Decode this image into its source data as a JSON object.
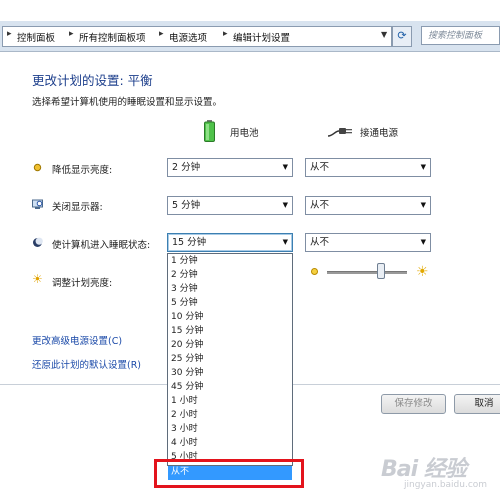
{
  "address_bar": {
    "breadcrumbs": [
      "控制面板",
      "所有控制面板项",
      "电源选项",
      "编辑计划设置"
    ],
    "search_placeholder": "搜索控制面板"
  },
  "page": {
    "title": "更改计划的设置: 平衡",
    "subtitle": "选择希望计算机使用的睡眠设置和显示设置。",
    "col_battery": "用电池",
    "col_plugged": "接通电源"
  },
  "rows": [
    {
      "label": "降低显示亮度:",
      "battery": "2 分钟",
      "plugged": "从不"
    },
    {
      "label": "关闭显示器:",
      "battery": "5 分钟",
      "plugged": "从不"
    },
    {
      "label": "使计算机进入睡眠状态:",
      "battery": "15 分钟",
      "plugged": "从不"
    },
    {
      "label": "调整计划亮度:"
    }
  ],
  "brightness_plugged_level": 0.68,
  "links": {
    "advanced": "更改高级电源设置(C)",
    "restore": "还原此计划的默认设置(R)"
  },
  "buttons": {
    "save": "保存修改",
    "cancel": "取消"
  },
  "dropdown_options": [
    "1 分钟",
    "2 分钟",
    "3 分钟",
    "5 分钟",
    "10 分钟",
    "15 分钟",
    "20 分钟",
    "25 分钟",
    "30 分钟",
    "45 分钟",
    "1 小时",
    "2 小时",
    "3 小时",
    "4 小时",
    "5 小时",
    "从不"
  ],
  "dropdown_selected": "从不",
  "watermark": "Bai 经验",
  "watermark_sub": "jingyan.baidu.com"
}
